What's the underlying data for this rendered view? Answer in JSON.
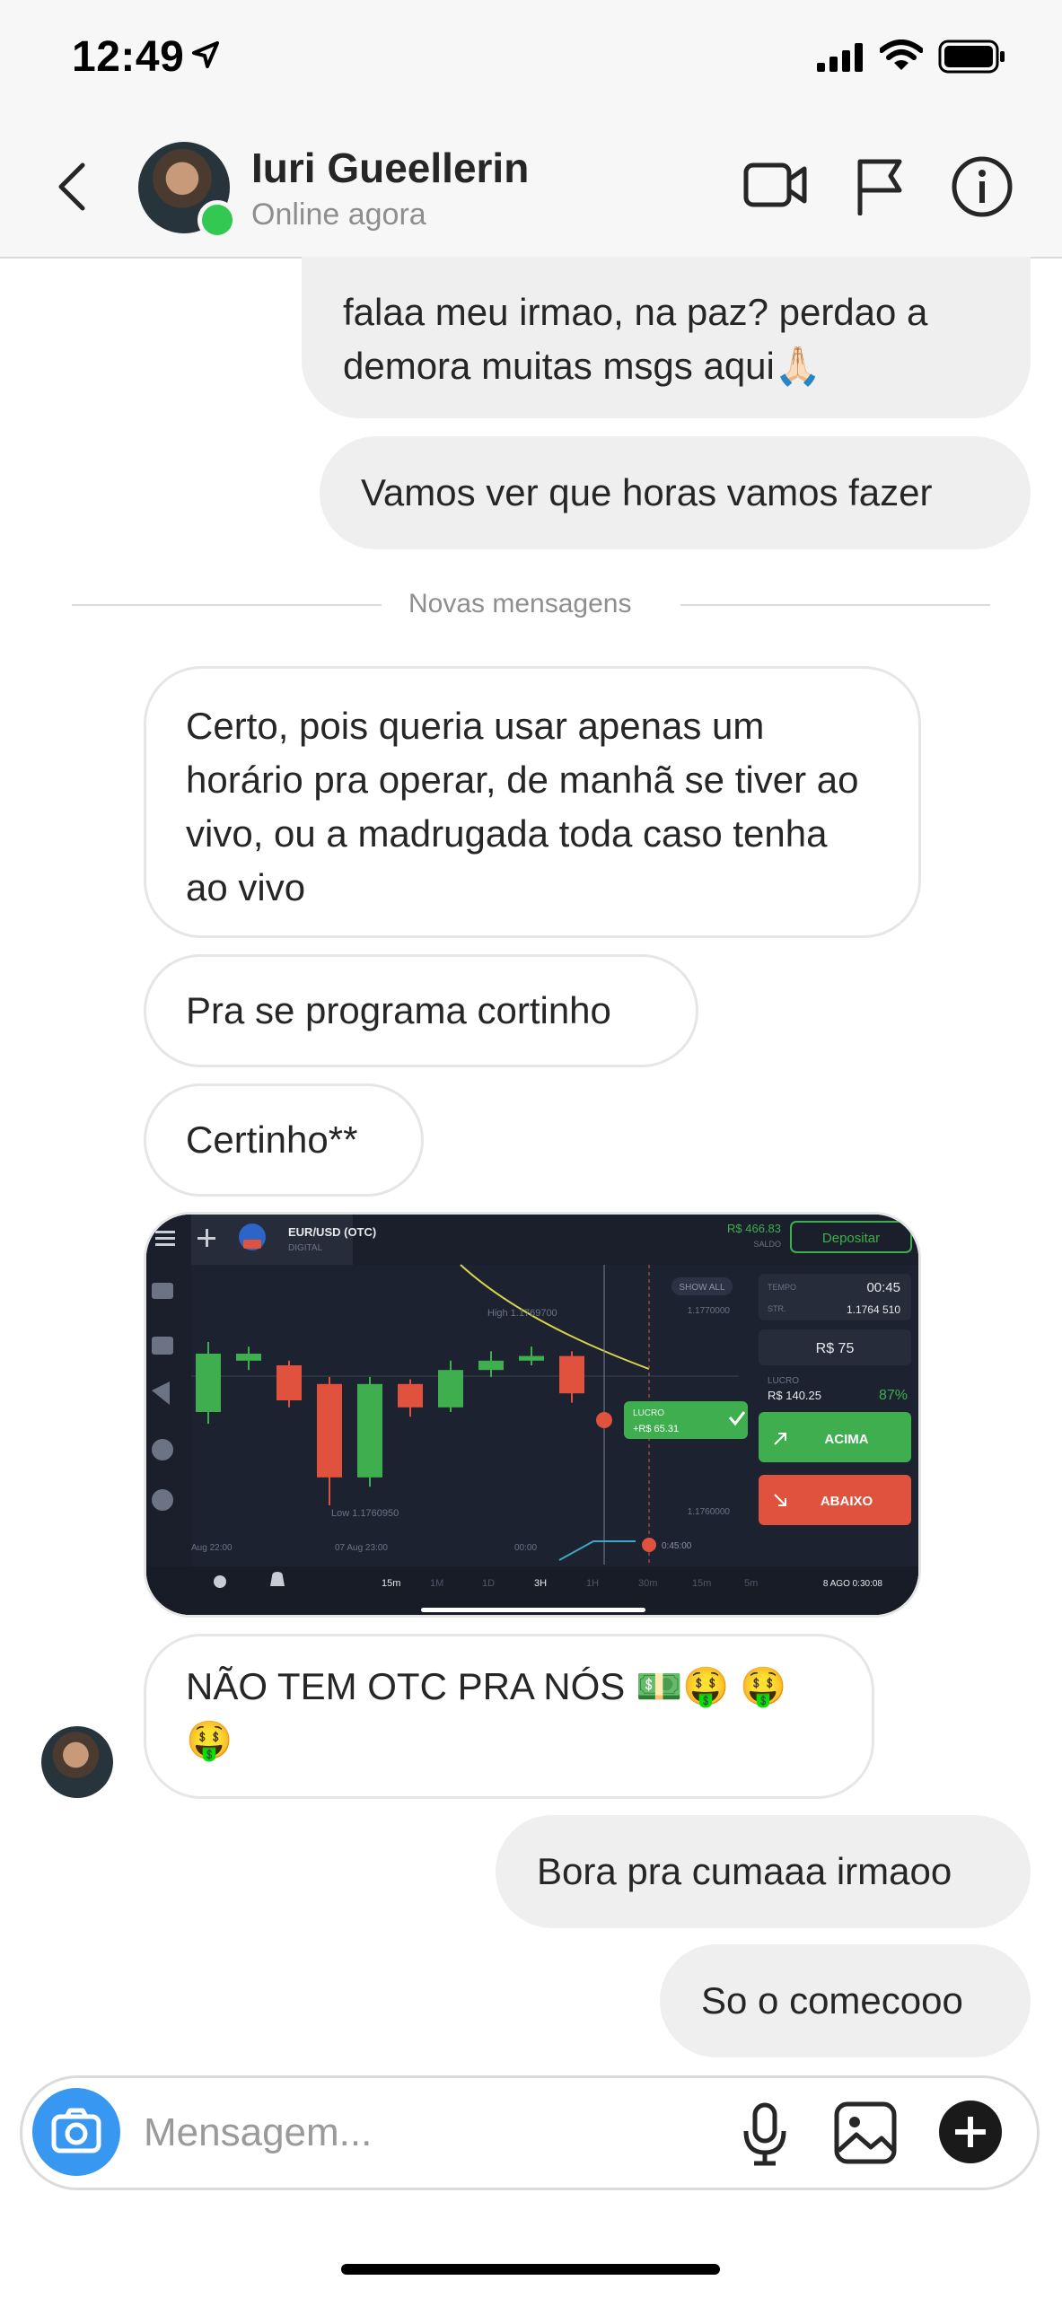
{
  "status_bar": {
    "time": "12:49"
  },
  "header": {
    "name": "Iuri Gueellerin",
    "status": "Online agora"
  },
  "messages": [
    {
      "side": "out",
      "text": "falaa meu irmao, na paz? perdao a demora muitas msgs aqui🙏🏻"
    },
    {
      "side": "out",
      "text": "Vamos ver que horas vamos fazer"
    },
    {
      "side": "divider",
      "text": "Novas mensagens"
    },
    {
      "side": "in",
      "text": "Certo, pois queria usar apenas um horário pra operar, de manhã se tiver ao vivo, ou a madrugada toda caso tenha ao vivo"
    },
    {
      "side": "in",
      "text": "Pra se programa cortinho"
    },
    {
      "side": "in",
      "text": "Certinho**"
    },
    {
      "side": "in",
      "text": "NÃO TEM OTC PRA NÓS 💵🤑 🤑 🤑"
    },
    {
      "side": "out",
      "text": "Bora pra cumaaa irmaoo"
    },
    {
      "side": "out",
      "text": "So o comecooo"
    }
  ],
  "shared_image": {
    "asset": "EUR/USD (OTC)",
    "asset_type": "DIGITAL",
    "balance": "R$ 466.83",
    "balance_label": "SALDO",
    "deposit": "Depositar",
    "show_all": "SHOW ALL",
    "high": "High 1.1769700",
    "low": "Low 1.1760950",
    "price_top": "1.1770000",
    "price_bottom": "1.1760000",
    "time_label": "TEMPO",
    "time_value": "00:45",
    "strike_label": "STR.",
    "strike_value": "1.1764 510",
    "amount": "R$ 75",
    "profit_label": "LUCRO",
    "profit_value": "R$ 140.25",
    "profit_pct": "87%",
    "up": "ACIMA",
    "down": "ABAIXO",
    "badge_label": "LUCRO",
    "badge_value": "+R$ 65.31",
    "timer": "0:45:00",
    "x_labels": [
      "Aug 22:00",
      "07 Aug 23:00",
      "00:00"
    ],
    "timeframes": [
      "15m",
      "1M",
      "1D",
      "3H",
      "1H",
      "30m",
      "15m",
      "5m"
    ],
    "datetime": "8 AGO 0:30:08",
    "candles": [
      {
        "dir": "up",
        "open": 1.1765,
        "close": 1.17675,
        "high": 1.1768,
        "low": 1.17645
      },
      {
        "dir": "up",
        "open": 1.17672,
        "close": 1.17675,
        "high": 1.17678,
        "low": 1.17668
      },
      {
        "dir": "down",
        "open": 1.1767,
        "close": 1.17655,
        "high": 1.17672,
        "low": 1.17652
      },
      {
        "dir": "down",
        "open": 1.17662,
        "close": 1.17622,
        "high": 1.17665,
        "low": 1.1761
      },
      {
        "dir": "up",
        "open": 1.17622,
        "close": 1.17662,
        "high": 1.17665,
        "low": 1.17618
      },
      {
        "dir": "down",
        "open": 1.17662,
        "close": 1.17652,
        "high": 1.17664,
        "low": 1.17648
      },
      {
        "dir": "up",
        "open": 1.17652,
        "close": 1.17668,
        "high": 1.17672,
        "low": 1.1765
      },
      {
        "dir": "up",
        "open": 1.17668,
        "close": 1.17672,
        "high": 1.17676,
        "low": 1.17665
      },
      {
        "dir": "up",
        "open": 1.17672,
        "close": 1.17674,
        "high": 1.17678,
        "low": 1.1767
      },
      {
        "dir": "down",
        "open": 1.17674,
        "close": 1.17658,
        "high": 1.17676,
        "low": 1.17654
      }
    ]
  },
  "composer": {
    "placeholder": "Mensagem..."
  },
  "colors": {
    "accent_blue": "#3897f0",
    "online_green": "#32c851",
    "bubble_out": "#efefef",
    "chart_up": "#3fae4f",
    "chart_down": "#e0523e"
  }
}
